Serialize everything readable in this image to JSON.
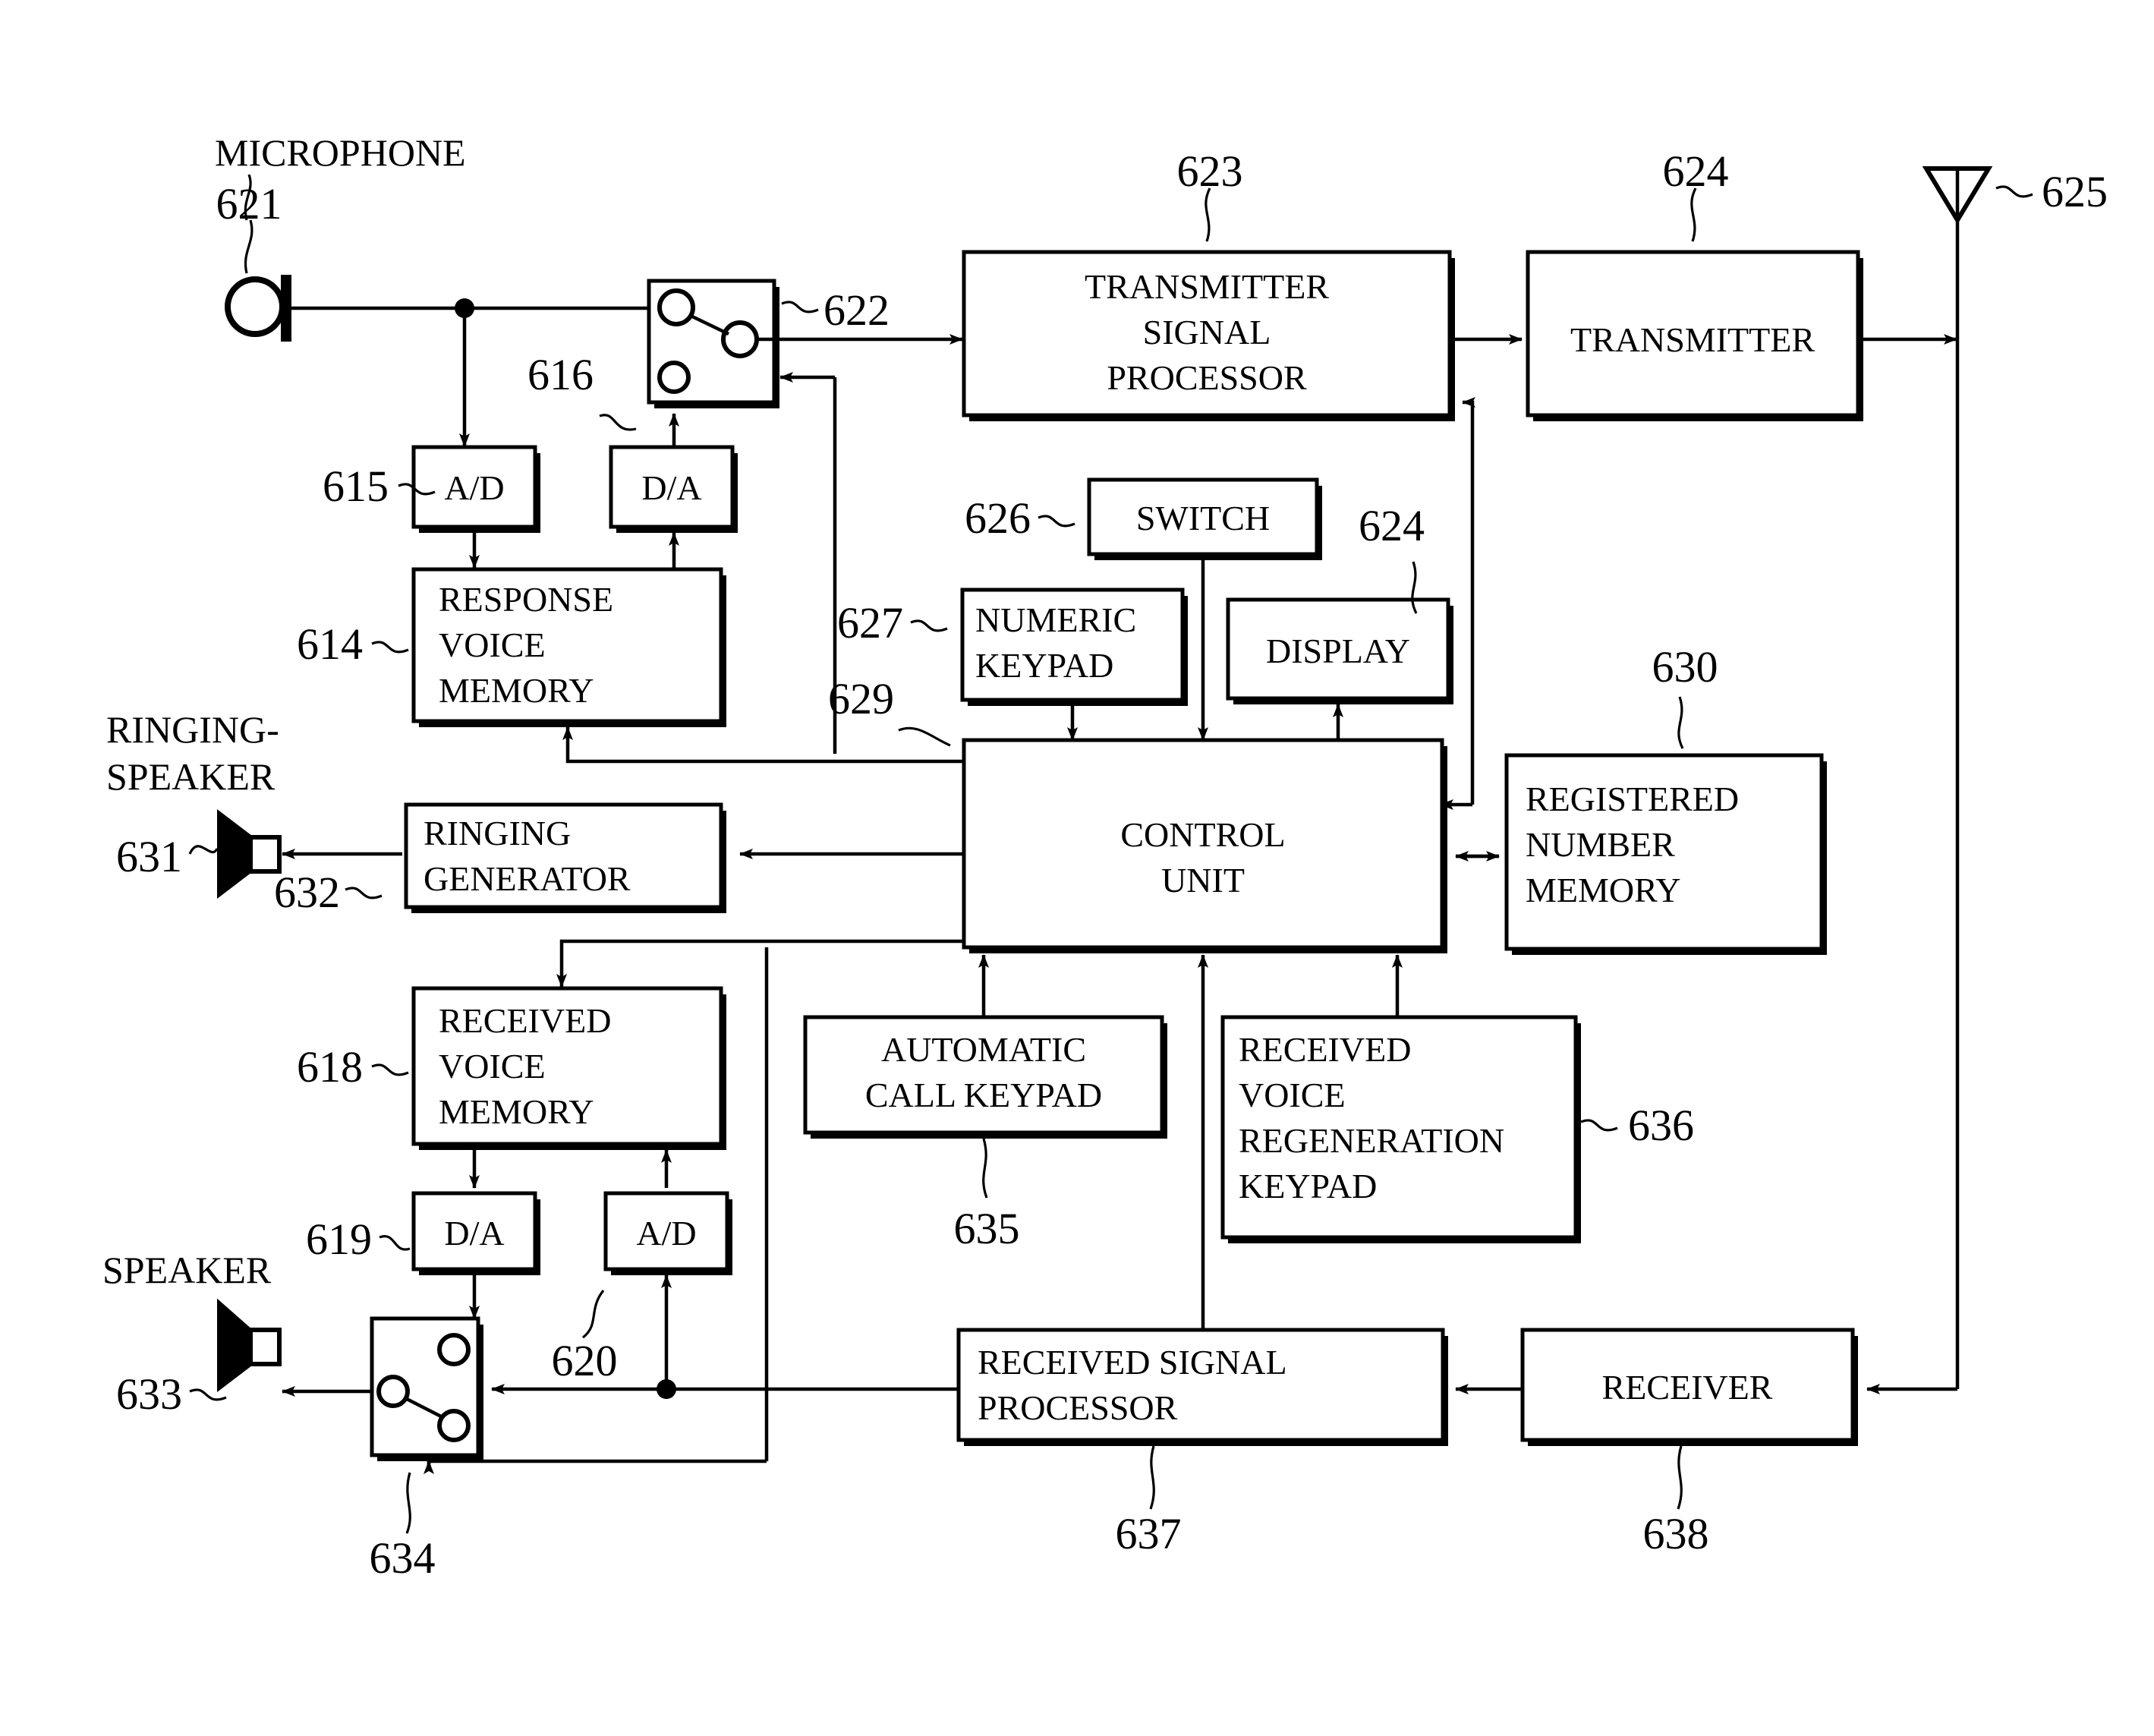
{
  "figure": {
    "type": "patent-block-diagram",
    "subject": "Wireless telephone with response/received voice memory",
    "background_color": "#ffffff",
    "line_color": "#000000"
  },
  "labels": {
    "microphone": "MICROPHONE",
    "ringing_speaker_line1": "RINGING-",
    "ringing_speaker_line2": "SPEAKER",
    "speaker": "SPEAKER"
  },
  "blocks": [
    {
      "id": "tx_signal_processor",
      "ref": "623",
      "lines": [
        "TRANSMITTER",
        "SIGNAL",
        "PROCESSOR"
      ],
      "align": "center"
    },
    {
      "id": "transmitter",
      "ref": "624",
      "lines": [
        "TRANSMITTER"
      ],
      "align": "center"
    },
    {
      "id": "switch_622",
      "ref": "622",
      "lines": [],
      "align": "center"
    },
    {
      "id": "ad_615",
      "ref": "615",
      "lines": [
        "A/D"
      ],
      "align": "center"
    },
    {
      "id": "da_616",
      "ref": "616",
      "lines": [
        "D/A"
      ],
      "align": "center"
    },
    {
      "id": "response_voice_memory",
      "ref": "614",
      "lines": [
        "RESPONSE",
        "VOICE",
        "MEMORY"
      ],
      "align": "left"
    },
    {
      "id": "switch_626",
      "ref": "626",
      "lines": [
        "SWITCH"
      ],
      "align": "center"
    },
    {
      "id": "numeric_keypad",
      "ref": "627",
      "lines": [
        "NUMERIC",
        "KEYPAD"
      ],
      "align": "left"
    },
    {
      "id": "display",
      "ref": "624",
      "lines": [
        "DISPLAY"
      ],
      "align": "center"
    },
    {
      "id": "control_unit",
      "ref": "629",
      "lines": [
        "CONTROL",
        "UNIT"
      ],
      "align": "center"
    },
    {
      "id": "registered_number_memory",
      "ref": "630",
      "lines": [
        "REGISTERED",
        "NUMBER",
        "MEMORY"
      ],
      "align": "left"
    },
    {
      "id": "ringing_generator",
      "ref": "632",
      "lines": [
        "RINGING",
        "GENERATOR"
      ],
      "align": "left"
    },
    {
      "id": "received_voice_memory",
      "ref": "618",
      "lines": [
        "RECEIVED",
        "VOICE",
        "MEMORY"
      ],
      "align": "left"
    },
    {
      "id": "automatic_call_keypad",
      "ref": "635",
      "lines": [
        "AUTOMATIC",
        "CALL  KEYPAD"
      ],
      "align": "center"
    },
    {
      "id": "received_voice_regeneration_keypad",
      "ref": "636",
      "lines": [
        "RECEIVED",
        "VOICE",
        "REGENERATION",
        "KEYPAD"
      ],
      "align": "left"
    },
    {
      "id": "da_619",
      "ref": "619",
      "lines": [
        "D/A"
      ],
      "align": "center"
    },
    {
      "id": "ad_620",
      "ref": "620",
      "lines": [
        "A/D"
      ],
      "align": "center"
    },
    {
      "id": "received_signal_processor",
      "ref": "637",
      "lines": [
        "RECEIVED  SIGNAL",
        "PROCESSOR"
      ],
      "align": "left"
    },
    {
      "id": "receiver",
      "ref": "638",
      "lines": [
        "RECEIVER"
      ],
      "align": "center"
    }
  ],
  "symbols": [
    {
      "id": "microphone",
      "ref": "621",
      "kind": "microphone-icon"
    },
    {
      "id": "antenna",
      "ref": "625",
      "kind": "antenna-icon"
    },
    {
      "id": "ringing_speaker",
      "ref": "631",
      "kind": "speaker-icon"
    },
    {
      "id": "speaker",
      "ref": "633",
      "kind": "speaker-icon"
    },
    {
      "id": "switch_634",
      "ref": "634",
      "kind": "switch-icon"
    },
    {
      "id": "switch_622_sym",
      "ref": "622",
      "kind": "switch-icon"
    }
  ],
  "reference_numerals": [
    "621",
    "622",
    "623",
    "624",
    "625",
    "615",
    "616",
    "614",
    "626",
    "627",
    "629",
    "630",
    "631",
    "632",
    "618",
    "619",
    "620",
    "633",
    "634",
    "635",
    "636",
    "637",
    "638",
    "624"
  ],
  "box_text": {
    "tx_signal_processor": {
      "l1": "TRANSMITTER",
      "l2": "SIGNAL",
      "l3": "PROCESSOR"
    },
    "transmitter": {
      "l1": "TRANSMITTER"
    },
    "ad_615": {
      "l1": "A/D"
    },
    "da_616": {
      "l1": "D/A"
    },
    "response_voice_memory": {
      "l1": "RESPONSE",
      "l2": "VOICE",
      "l3": "MEMORY"
    },
    "switch_626": {
      "l1": "SWITCH"
    },
    "numeric_keypad": {
      "l1": "NUMERIC",
      "l2": "KEYPAD"
    },
    "display": {
      "l1": "DISPLAY"
    },
    "control_unit": {
      "l1": "CONTROL",
      "l2": "UNIT"
    },
    "registered_number_memory": {
      "l1": "REGISTERED",
      "l2": "NUMBER",
      "l3": "MEMORY"
    },
    "ringing_generator": {
      "l1": "RINGING",
      "l2": "GENERATOR"
    },
    "received_voice_memory": {
      "l1": "RECEIVED",
      "l2": "VOICE",
      "l3": "MEMORY"
    },
    "automatic_call_keypad": {
      "l1": "AUTOMATIC",
      "l2": "CALL  KEYPAD"
    },
    "received_voice_regeneration_keypad": {
      "l1": "RECEIVED",
      "l2": "VOICE",
      "l3": "REGENERATION",
      "l4": "KEYPAD"
    },
    "da_619": {
      "l1": "D/A"
    },
    "ad_620": {
      "l1": "A/D"
    },
    "received_signal_processor": {
      "l1": "RECEIVED  SIGNAL",
      "l2": "PROCESSOR"
    },
    "receiver": {
      "l1": "RECEIVER"
    }
  },
  "refs": {
    "r621": "621",
    "r622": "622",
    "r623": "623",
    "r624_tx": "624",
    "r624_disp": "624",
    "r625": "625",
    "r615": "615",
    "r616": "616",
    "r614": "614",
    "r626": "626",
    "r627": "627",
    "r629": "629",
    "r630": "630",
    "r631": "631",
    "r632": "632",
    "r618": "618",
    "r619": "619",
    "r620": "620",
    "r633": "633",
    "r634": "634",
    "r635": "635",
    "r636": "636",
    "r637": "637",
    "r638": "638"
  }
}
